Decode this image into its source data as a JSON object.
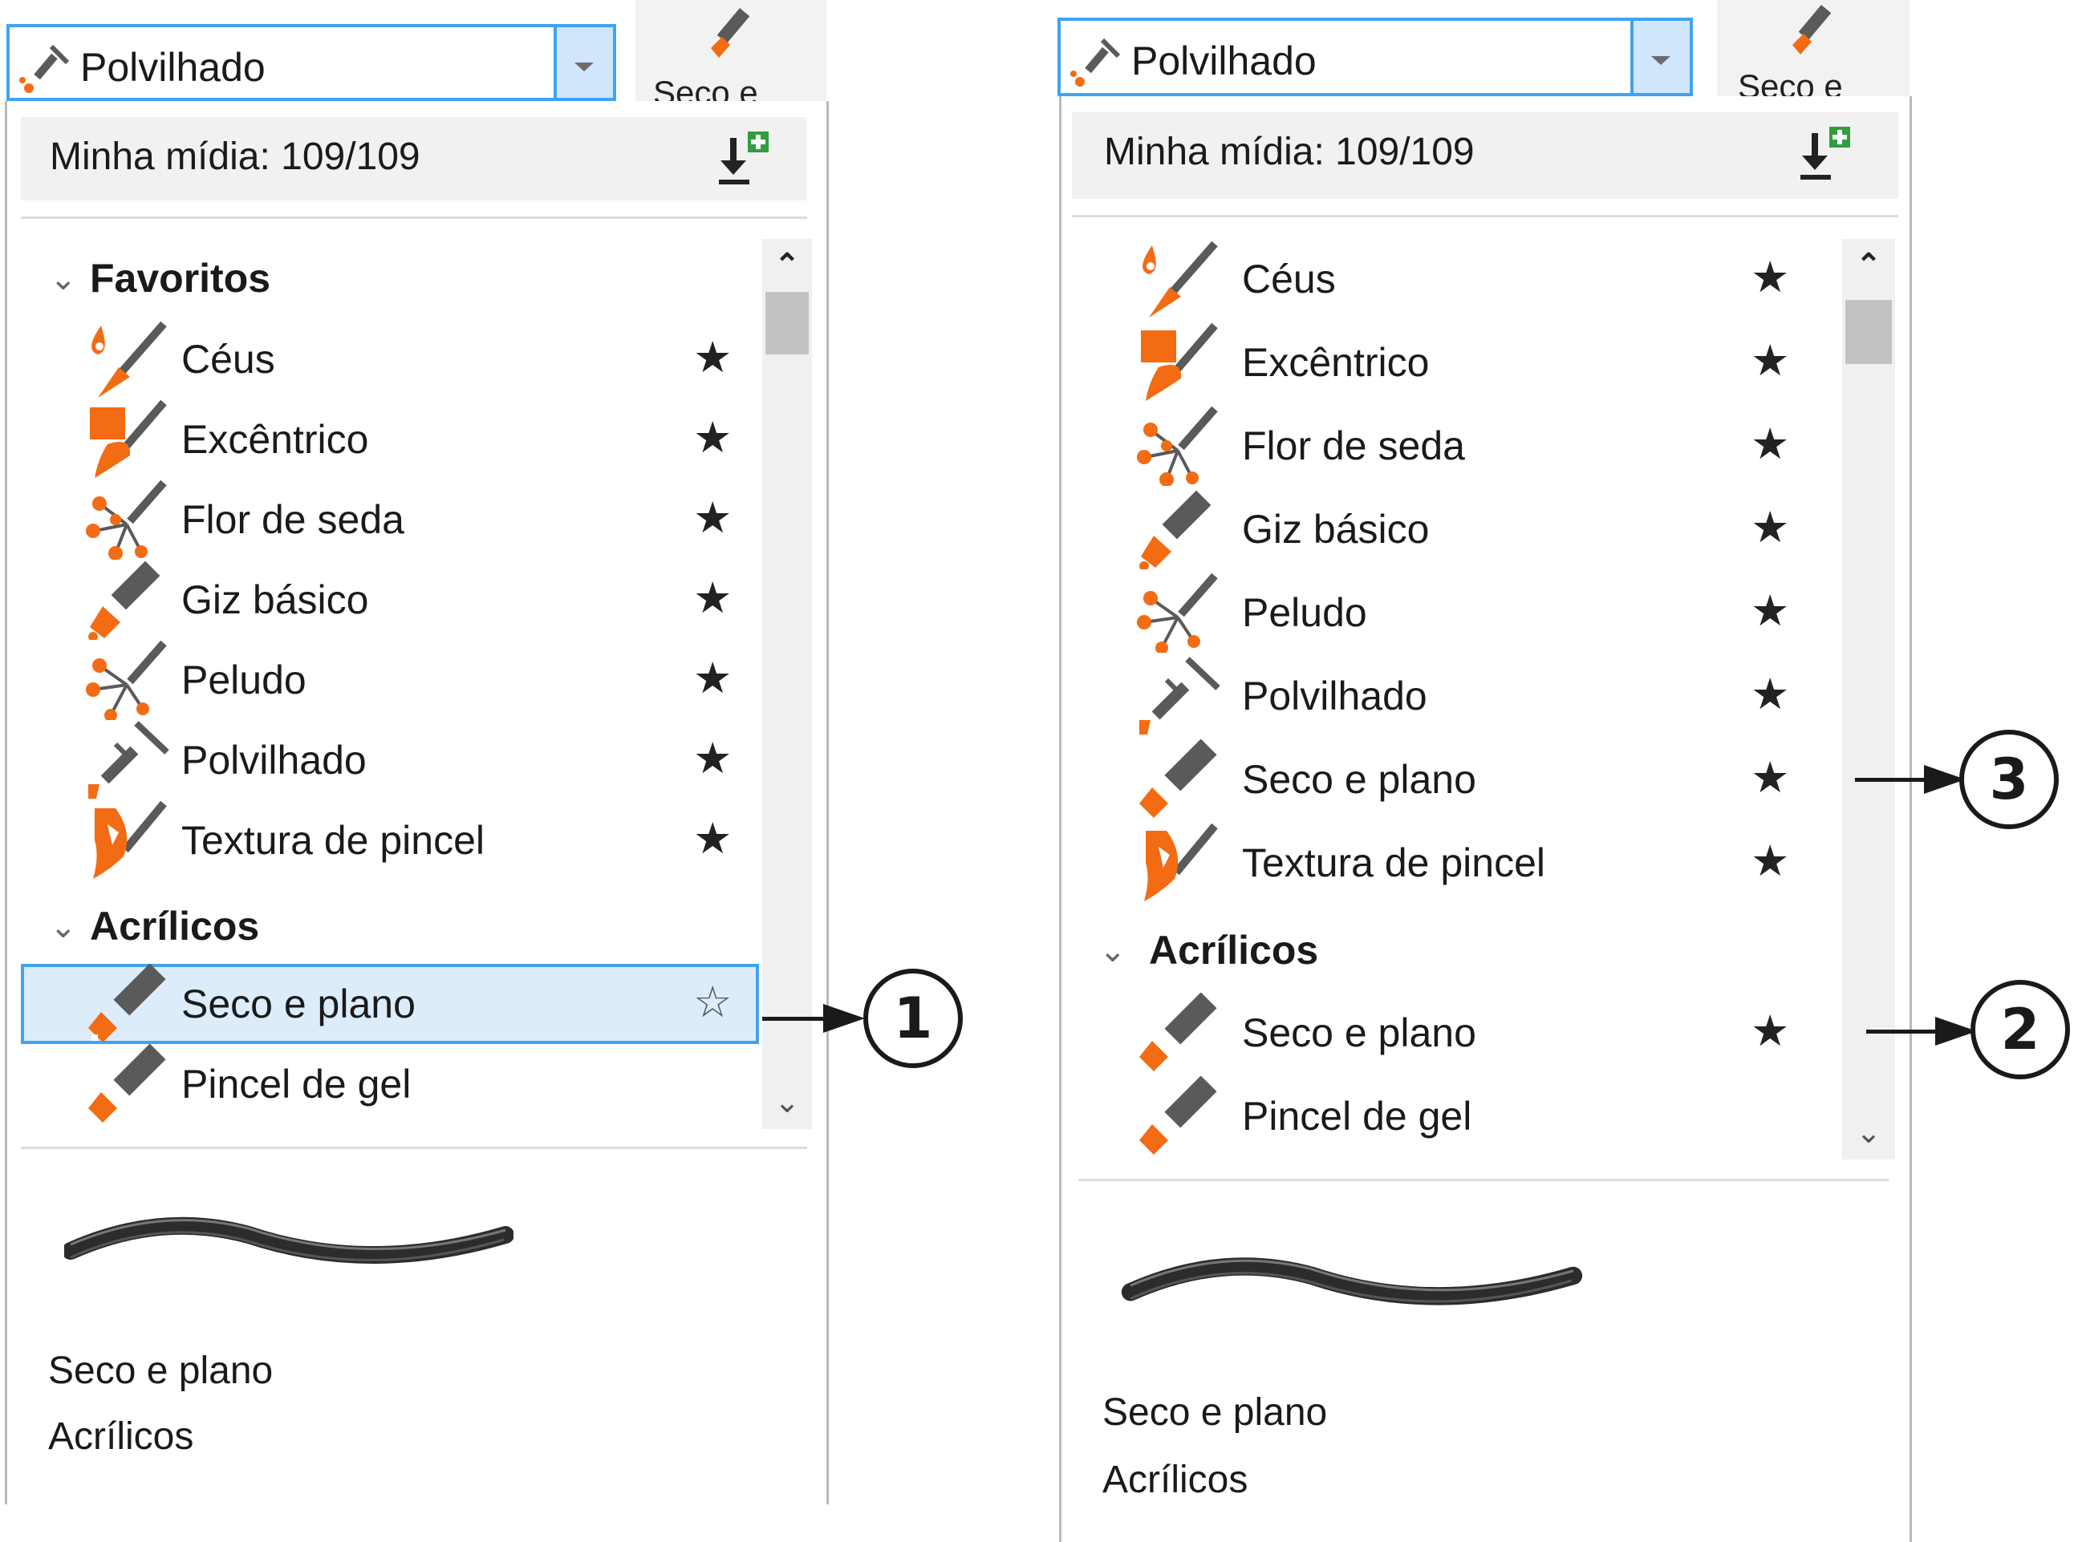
{
  "colors": {
    "accent_blue": "#41a3ef",
    "selection_bg": "#dcecfb",
    "icon_orange": "#f36b12",
    "icon_gray": "#5a5a5a"
  },
  "left_panel": {
    "dropdown": {
      "value": "Polvilhado",
      "icon": "sprinkler-brush-icon"
    },
    "top_button": {
      "label": "Seco e",
      "icon": "dry-flat-brush-icon"
    },
    "header": {
      "text": "Minha mídia: 109/109",
      "icon": "import-media-icon"
    },
    "groups": [
      {
        "title": "Favoritos",
        "items": [
          {
            "label": "Céus",
            "icon": "skies-brush-icon",
            "starred": true
          },
          {
            "label": "Excêntrico",
            "icon": "eccentric-brush-icon",
            "starred": true
          },
          {
            "label": "Flor de seda",
            "icon": "silk-flower-brush-icon",
            "starred": true
          },
          {
            "label": "Giz básico",
            "icon": "basic-chalk-brush-icon",
            "starred": true
          },
          {
            "label": "Peludo",
            "icon": "hairy-brush-icon",
            "starred": true
          },
          {
            "label": "Polvilhado",
            "icon": "sprinkler-brush-icon",
            "starred": true
          },
          {
            "label": "Textura de pincel",
            "icon": "brush-texture-icon",
            "starred": true
          }
        ]
      },
      {
        "title": "Acrílicos",
        "items": [
          {
            "label": "Seco e plano",
            "icon": "dry-flat-brush-icon",
            "starred": false,
            "selected": true
          },
          {
            "label": "Pincel de gel",
            "icon": "gel-brush-icon",
            "starred": false
          }
        ]
      }
    ],
    "preview": {
      "name": "Seco e plano",
      "category": "Acrílicos"
    }
  },
  "right_panel": {
    "dropdown": {
      "value": "Polvilhado",
      "icon": "sprinkler-brush-icon"
    },
    "top_button": {
      "label": "Seco e",
      "icon": "dry-flat-brush-icon"
    },
    "header": {
      "text": "Minha mídia: 109/109",
      "icon": "import-media-icon"
    },
    "favorites": [
      {
        "label": "Céus",
        "icon": "skies-brush-icon",
        "starred": true
      },
      {
        "label": "Excêntrico",
        "icon": "eccentric-brush-icon",
        "starred": true
      },
      {
        "label": "Flor de seda",
        "icon": "silk-flower-brush-icon",
        "starred": true
      },
      {
        "label": "Giz básico",
        "icon": "basic-chalk-brush-icon",
        "starred": true
      },
      {
        "label": "Peludo",
        "icon": "hairy-brush-icon",
        "starred": true
      },
      {
        "label": "Polvilhado",
        "icon": "sprinkler-brush-icon",
        "starred": true
      },
      {
        "label": "Seco e plano",
        "icon": "dry-flat-brush-icon",
        "starred": true
      },
      {
        "label": "Textura de pincel",
        "icon": "brush-texture-icon",
        "starred": true
      }
    ],
    "group": {
      "title": "Acrílicos",
      "items": [
        {
          "label": "Seco e plano",
          "icon": "dry-flat-brush-icon",
          "starred": true
        },
        {
          "label": "Pincel de gel",
          "icon": "gel-brush-icon",
          "starred": false
        }
      ]
    },
    "preview": {
      "name": "Seco e plano",
      "category": "Acrílicos"
    }
  },
  "callouts": [
    "1",
    "2",
    "3"
  ],
  "star_filled": "★",
  "star_empty": "☆",
  "scroll_up": "⌃",
  "scroll_down": "⌄",
  "chevron": "⌄"
}
